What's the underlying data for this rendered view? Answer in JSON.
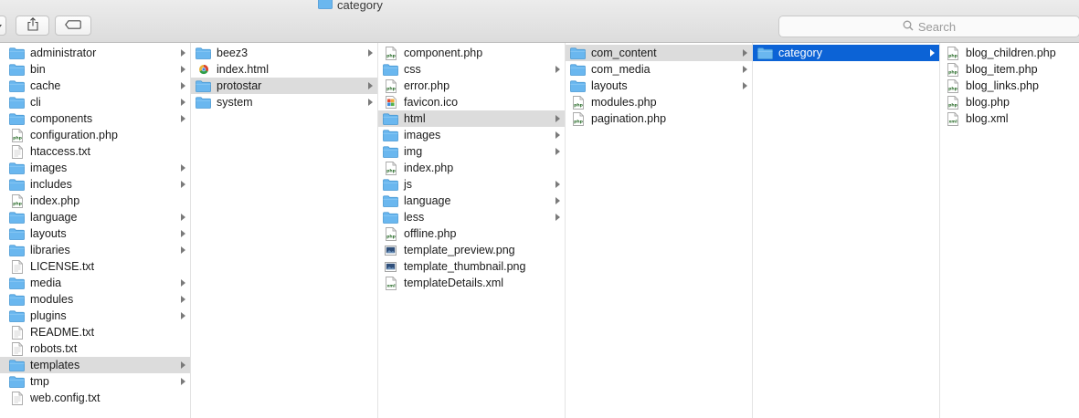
{
  "window": {
    "title": "category"
  },
  "toolbar": {
    "search_placeholder": "Search",
    "share_icon": "share-icon",
    "tag_icon": "tag-icon"
  },
  "colors": {
    "selection": "#0c63d6",
    "inactive_selection": "#dcdcdc",
    "folder": "#6ab7ef"
  },
  "columns": [
    {
      "items": [
        {
          "name": "administrator",
          "type": "folder",
          "arrow": true
        },
        {
          "name": "bin",
          "type": "folder",
          "arrow": true
        },
        {
          "name": "cache",
          "type": "folder",
          "arrow": true
        },
        {
          "name": "cli",
          "type": "folder",
          "arrow": true
        },
        {
          "name": "components",
          "type": "folder",
          "arrow": true
        },
        {
          "name": "configuration.php",
          "type": "php"
        },
        {
          "name": "htaccess.txt",
          "type": "txt"
        },
        {
          "name": "images",
          "type": "folder",
          "arrow": true
        },
        {
          "name": "includes",
          "type": "folder",
          "arrow": true
        },
        {
          "name": "index.php",
          "type": "php"
        },
        {
          "name": "language",
          "type": "folder",
          "arrow": true
        },
        {
          "name": "layouts",
          "type": "folder",
          "arrow": true
        },
        {
          "name": "libraries",
          "type": "folder",
          "arrow": true
        },
        {
          "name": "LICENSE.txt",
          "type": "txt"
        },
        {
          "name": "media",
          "type": "folder",
          "arrow": true
        },
        {
          "name": "modules",
          "type": "folder",
          "arrow": true
        },
        {
          "name": "plugins",
          "type": "folder",
          "arrow": true
        },
        {
          "name": "README.txt",
          "type": "txt"
        },
        {
          "name": "robots.txt",
          "type": "txt"
        },
        {
          "name": "templates",
          "type": "folder",
          "arrow": true,
          "state": "sel"
        },
        {
          "name": "tmp",
          "type": "folder",
          "arrow": true
        },
        {
          "name": "web.config.txt",
          "type": "txt"
        }
      ]
    },
    {
      "items": [
        {
          "name": "beez3",
          "type": "folder",
          "arrow": true
        },
        {
          "name": "index.html",
          "type": "html"
        },
        {
          "name": "protostar",
          "type": "folder",
          "arrow": true,
          "state": "sel"
        },
        {
          "name": "system",
          "type": "folder",
          "arrow": true
        }
      ]
    },
    {
      "items": [
        {
          "name": "component.php",
          "type": "php"
        },
        {
          "name": "css",
          "type": "folder",
          "arrow": true
        },
        {
          "name": "error.php",
          "type": "php"
        },
        {
          "name": "favicon.ico",
          "type": "ico"
        },
        {
          "name": "html",
          "type": "folder",
          "arrow": true,
          "state": "sel"
        },
        {
          "name": "images",
          "type": "folder",
          "arrow": true
        },
        {
          "name": "img",
          "type": "folder",
          "arrow": true
        },
        {
          "name": "index.php",
          "type": "php"
        },
        {
          "name": "js",
          "type": "folder",
          "arrow": true
        },
        {
          "name": "language",
          "type": "folder",
          "arrow": true
        },
        {
          "name": "less",
          "type": "folder",
          "arrow": true
        },
        {
          "name": "offline.php",
          "type": "php"
        },
        {
          "name": "template_preview.png",
          "type": "png"
        },
        {
          "name": "template_thumbnail.png",
          "type": "png"
        },
        {
          "name": "templateDetails.xml",
          "type": "xml"
        }
      ]
    },
    {
      "items": [
        {
          "name": "com_content",
          "type": "folder",
          "arrow": true,
          "state": "sel"
        },
        {
          "name": "com_media",
          "type": "folder",
          "arrow": true
        },
        {
          "name": "layouts",
          "type": "folder",
          "arrow": true
        },
        {
          "name": "modules.php",
          "type": "php"
        },
        {
          "name": "pagination.php",
          "type": "php"
        }
      ]
    },
    {
      "items": [
        {
          "name": "category",
          "type": "folder",
          "arrow": true,
          "state": "active"
        }
      ]
    },
    {
      "items": [
        {
          "name": "blog_children.php",
          "type": "php"
        },
        {
          "name": "blog_item.php",
          "type": "php"
        },
        {
          "name": "blog_links.php",
          "type": "php"
        },
        {
          "name": "blog.php",
          "type": "php"
        },
        {
          "name": "blog.xml",
          "type": "xml"
        }
      ]
    }
  ]
}
